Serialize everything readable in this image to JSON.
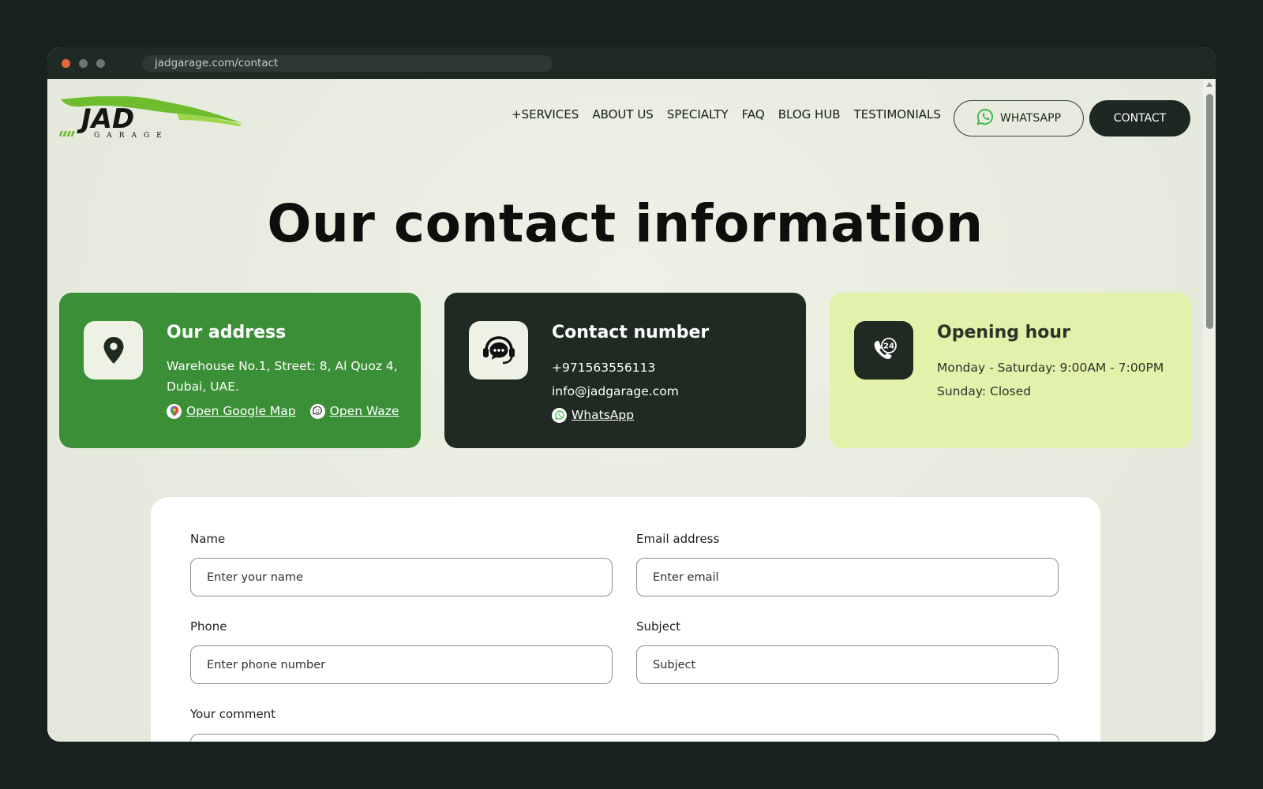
{
  "browser": {
    "url": "jadgarage.com/contact"
  },
  "header": {
    "logo_text": "JAD",
    "logo_subtext": "GARAGE",
    "nav": [
      "+SERVICES",
      "ABOUT US",
      "SPECIALTY",
      "FAQ",
      "BLOG HUB",
      "TESTIMONIALS"
    ],
    "whatsapp_label": "WHATSAPP",
    "contact_label": "CONTACT"
  },
  "hero": {
    "title": "Our contact information"
  },
  "cards": {
    "address": {
      "title": "Our address",
      "line1": "Warehouse No.1, Street: 8, Al Quoz 4,",
      "line2": "Dubai, UAE.",
      "google_map": "Open Google Map",
      "waze": "Open Waze",
      "icon": "map-pin-icon"
    },
    "contact": {
      "title": "Contact number",
      "phone": "+971563556113",
      "email": "info@jadgarage.com",
      "whatsapp": "WhatsApp",
      "icon": "headset-chat-icon"
    },
    "hours": {
      "title": "Opening hour",
      "weekdays": "Monday - Saturday: 9:00AM - 7:00PM",
      "sunday": "Sunday: Closed",
      "icon": "phone-24-icon"
    }
  },
  "form": {
    "name_label": "Name",
    "name_placeholder": "Enter your name",
    "email_label": "Email address",
    "email_placeholder": "Enter email",
    "phone_label": "Phone",
    "phone_placeholder": "Enter phone number",
    "subject_label": "Subject",
    "subject_placeholder": "Subject",
    "comment_label": "Your comment"
  },
  "colors": {
    "brand_green": "#3b9037",
    "dark": "#1f2a23",
    "lime": "#e2f2aa",
    "page_bg": "#e9eddf"
  }
}
